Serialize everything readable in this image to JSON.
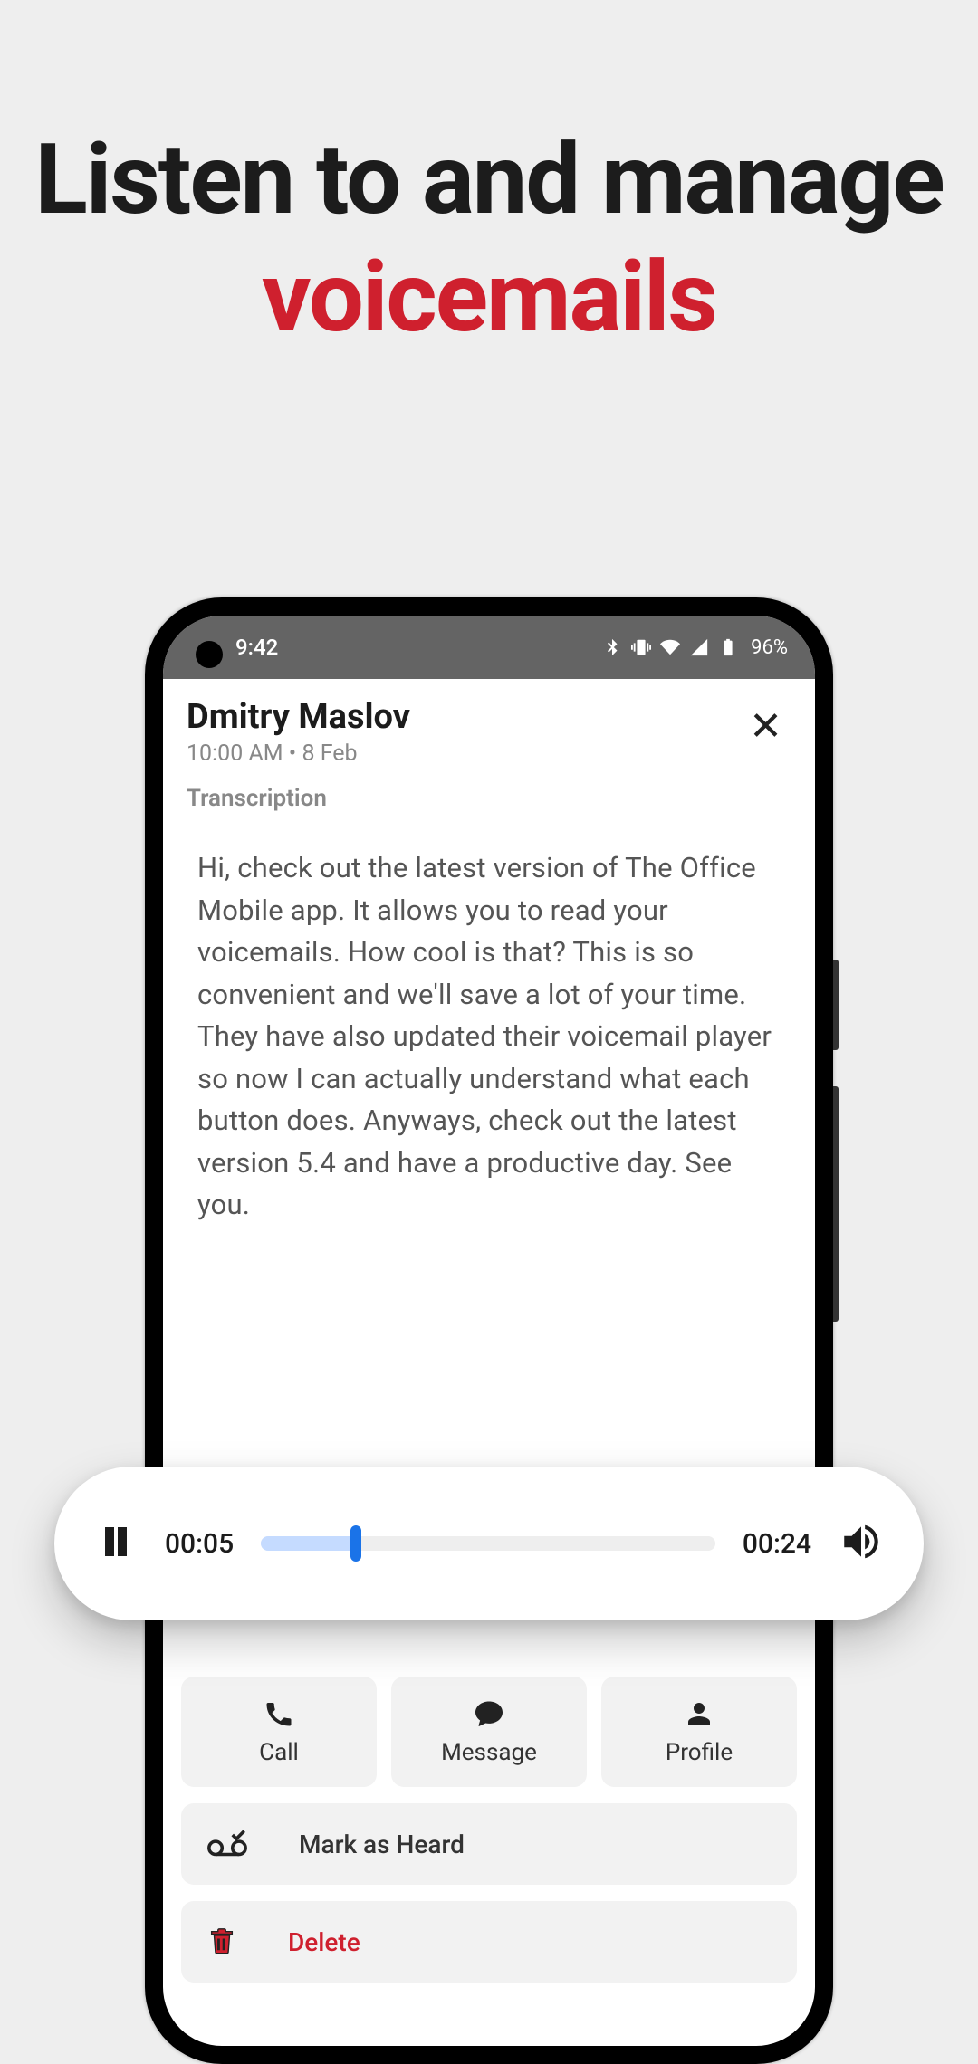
{
  "headline": {
    "line1": "Listen to and manage",
    "line2": "voicemails"
  },
  "status": {
    "time": "9:42",
    "battery": "96%"
  },
  "voicemail": {
    "caller": "Dmitry Maslov",
    "time": "10:00 AM",
    "date": "8 Feb",
    "transcription_label": "Transcription",
    "transcription": "Hi, check out the latest version of The Office Mobile app. It allows you to read your voicemails. How cool is that? This is so convenient and we'll save a lot of your time. They have also updated their voicemail player so now I can actually understand what each button does. Anyways, check out the latest version 5.4 and have a productive day. See you."
  },
  "player": {
    "elapsed": "00:05",
    "duration": "00:24",
    "progress_pct": 21
  },
  "actions": {
    "call": "Call",
    "message": "Message",
    "profile": "Profile",
    "mark_heard": "Mark as Heard",
    "delete": "Delete"
  }
}
